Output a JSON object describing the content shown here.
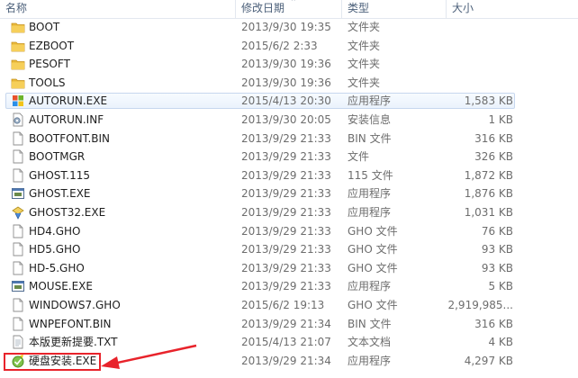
{
  "columns": {
    "name": "名称",
    "date": "修改日期",
    "type": "类型",
    "size": "大小"
  },
  "files": [
    {
      "name": "BOOT",
      "date": "2013/9/30 19:35",
      "type": "文件夹",
      "size": "",
      "icon": "folder-icon"
    },
    {
      "name": "EZBOOT",
      "date": "2015/6/2 2:33",
      "type": "文件夹",
      "size": "",
      "icon": "folder-icon"
    },
    {
      "name": "PESOFT",
      "date": "2013/9/30 19:36",
      "type": "文件夹",
      "size": "",
      "icon": "folder-icon"
    },
    {
      "name": "TOOLS",
      "date": "2013/9/30 19:36",
      "type": "文件夹",
      "size": "",
      "icon": "folder-icon"
    },
    {
      "name": "AUTORUN.EXE",
      "date": "2015/4/13 20:30",
      "type": "应用程序",
      "size": "1,583 KB",
      "icon": "windows-flag-icon"
    },
    {
      "name": "AUTORUN.INF",
      "date": "2013/9/30 20:05",
      "type": "安装信息",
      "size": "1 KB",
      "icon": "gear-file-icon"
    },
    {
      "name": "BOOTFONT.BIN",
      "date": "2013/9/29 21:33",
      "type": "BIN 文件",
      "size": "316 KB",
      "icon": "file-icon"
    },
    {
      "name": "BOOTMGR",
      "date": "2013/9/29 21:33",
      "type": "文件",
      "size": "326 KB",
      "icon": "file-icon"
    },
    {
      "name": "GHOST.115",
      "date": "2013/9/29 21:33",
      "type": "115 文件",
      "size": "1,872 KB",
      "icon": "file-icon"
    },
    {
      "name": "GHOST.EXE",
      "date": "2013/9/29 21:33",
      "type": "应用程序",
      "size": "1,876 KB",
      "icon": "app-window-icon"
    },
    {
      "name": "GHOST32.EXE",
      "date": "2013/9/29 21:33",
      "type": "应用程序",
      "size": "1,031 KB",
      "icon": "ghost-icon"
    },
    {
      "name": "HD4.GHO",
      "date": "2013/9/29 21:33",
      "type": "GHO 文件",
      "size": "76 KB",
      "icon": "file-icon"
    },
    {
      "name": "HD5.GHO",
      "date": "2013/9/29 21:33",
      "type": "GHO 文件",
      "size": "93 KB",
      "icon": "file-icon"
    },
    {
      "name": "HD-5.GHO",
      "date": "2013/9/29 21:33",
      "type": "GHO 文件",
      "size": "93 KB",
      "icon": "file-icon"
    },
    {
      "name": "MOUSE.EXE",
      "date": "2013/9/29 21:33",
      "type": "应用程序",
      "size": "5 KB",
      "icon": "app-window-icon"
    },
    {
      "name": "WINDOWS7.GHO",
      "date": "2015/6/2 19:13",
      "type": "GHO 文件",
      "size": "2,919,985...",
      "icon": "file-icon"
    },
    {
      "name": "WNPEFONT.BIN",
      "date": "2013/9/29 21:34",
      "type": "BIN 文件",
      "size": "316 KB",
      "icon": "file-icon"
    },
    {
      "name": "本版更新提要.TXT",
      "date": "2015/4/13 21:07",
      "type": "文本文档",
      "size": "4 KB",
      "icon": "text-file-icon"
    },
    {
      "name": "硬盘安装.EXE",
      "date": "2013/9/29 21:34",
      "type": "应用程序",
      "size": "4,297 KB",
      "icon": "installer-icon"
    }
  ],
  "hovered_row": "AUTORUN.EXE",
  "highlighted_row": "硬盘安装.EXE",
  "colors": {
    "annotation_red": "#e8232b",
    "folder_yellow": "#e8b83a",
    "hover_border": "#c7d7ee"
  }
}
